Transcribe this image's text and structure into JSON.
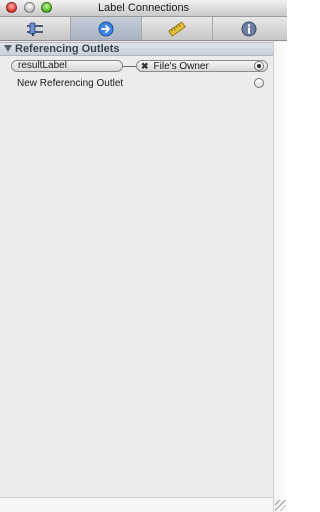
{
  "window": {
    "title": "Label Connections"
  },
  "tabs": [
    {
      "name": "attributes",
      "icon": "slider-icon"
    },
    {
      "name": "connections",
      "icon": "arrow-circle-icon",
      "active": true
    },
    {
      "name": "size",
      "icon": "ruler-icon"
    },
    {
      "name": "identity",
      "icon": "info-icon"
    }
  ],
  "section": {
    "title": "Referencing Outlets"
  },
  "rows": [
    {
      "outlet": "resultLabel",
      "target": "File's Owner",
      "connected": true
    },
    {
      "label": "New Referencing Outlet",
      "connected": false
    }
  ]
}
